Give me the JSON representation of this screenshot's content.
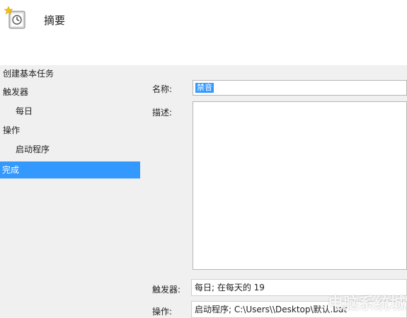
{
  "header": {
    "title": "摘要",
    "icon": "task-scheduler-clock-icon"
  },
  "sidebar": {
    "items": [
      {
        "label": "创建基本任务"
      },
      {
        "label": "触发器"
      },
      {
        "label": "每日"
      },
      {
        "label": "操作"
      },
      {
        "label": "启动程序"
      },
      {
        "label": "完成"
      }
    ],
    "selected_color": "#3399ff"
  },
  "form": {
    "name_label": "名称:",
    "name_value": "禁音",
    "description_label": "描述:",
    "trigger_label": "触发器:",
    "trigger_value": "每日; 在每天的 19",
    "action_label": "操作:",
    "action_value": "启动程序; C:\\Users\\\\Desktop\\默认.bat"
  },
  "watermark": {
    "text": "电脑系统城"
  }
}
